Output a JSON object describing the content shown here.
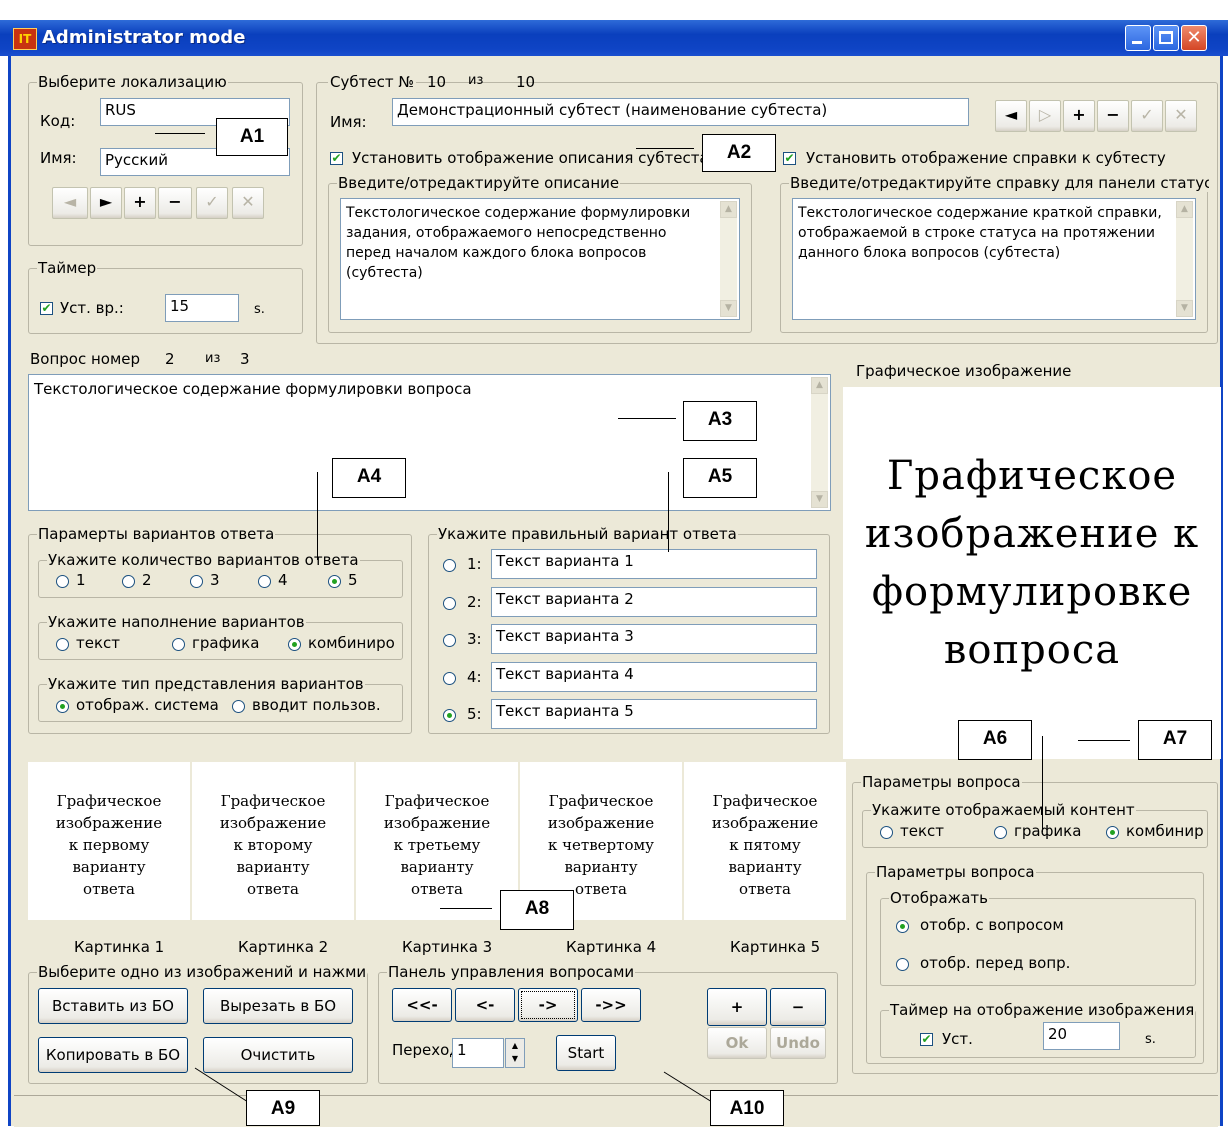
{
  "window": {
    "title": "Administrator mode"
  },
  "localization": {
    "group_title": "Выберите локализацию",
    "code_label": "Код:",
    "code_value": "RUS",
    "name_label": "Имя:",
    "name_value": "Русский"
  },
  "timer": {
    "group_title": "Таймер",
    "check_label": "Уст. вр.:",
    "value": "15",
    "unit": "s."
  },
  "subtest": {
    "label_no": "Субтест №",
    "number": "10",
    "of_label": "из",
    "total": "10",
    "name_label": "Имя:",
    "name_value": "Демонстрационный субтест (наименование субтеста)",
    "show_desc_label": "Установить отображение описания субтеста",
    "show_help_label": "Установить отображение справки к субтесту",
    "desc_group_title": "Введите/отредактируйте описание",
    "desc_text": "Текстологическое содержание формулировки задания, отображаемого непосредственно перед началом каждого блока вопросов (субтеста)",
    "help_group_title": "Введите/отредактируйте справку для панели статус",
    "help_text": "Текстологическое содержание краткой справки, отображаемой в строке статуса на протяжении данного блока вопросов (субтеста)"
  },
  "question": {
    "label": "Вопрос номер",
    "number": "2",
    "of_label": "из",
    "total": "3",
    "text": "Текстологическое содержание формулировки вопроса"
  },
  "graphic": {
    "label": "Графическое изображение",
    "image_text": "Графическое изображение к формулировке вопроса"
  },
  "answer_params": {
    "group_title": "Парамерты вариантов ответа",
    "count_title": "Укажите количество вариантов ответа",
    "count_options": [
      "1",
      "2",
      "3",
      "4",
      "5"
    ],
    "count_selected": "5",
    "fill_title": "Укажите наполнение вариантов",
    "fill_options": [
      "текст",
      "графика",
      "комбиниро"
    ],
    "fill_selected": "комбиниро",
    "type_title": "Укажите тип представления вариантов",
    "type_options": [
      "отображ. система",
      "вводит пользов."
    ],
    "type_selected": "отображ. система"
  },
  "correct": {
    "group_title": "Укажите правильный вариант ответа",
    "options": [
      {
        "num": "1:",
        "text": "Текст варианта 1"
      },
      {
        "num": "2:",
        "text": "Текст варианта 2"
      },
      {
        "num": "3:",
        "text": "Текст варианта 3"
      },
      {
        "num": "4:",
        "text": "Текст варианта 4"
      },
      {
        "num": "5:",
        "text": "Текст варианта 5"
      }
    ],
    "selected": "5"
  },
  "pictures": [
    {
      "text": "Графическое изображение к первому варианту ответа",
      "caption": "Картинка 1"
    },
    {
      "text": "Графическое изображение к второму варианту ответа",
      "caption": "Картинка 2"
    },
    {
      "text": "Графическое изображение к третьему варианту ответа",
      "caption": "Картинка 3"
    },
    {
      "text": "Графическое изображение к четвертому варианту ответа",
      "caption": "Картинка 4"
    },
    {
      "text": "Графическое изображение к пятому варианту ответа",
      "caption": "Картинка 5"
    }
  ],
  "clipboard": {
    "group_title": "Выберите одно из изображений и нажми",
    "insert": "Вставить из БО",
    "cut": "Вырезать в БО",
    "copy": "Копировать в БО",
    "clear": "Очистить"
  },
  "qpanel": {
    "group_title": "Панель управления вопросами",
    "first": "<<-",
    "prev": "<-",
    "next": "->",
    "last": "->>",
    "add": "+",
    "remove": "−",
    "ok": "Ok",
    "undo": "Undo",
    "goto_label": "Переход",
    "goto_value": "1",
    "start": "Start"
  },
  "qparams": {
    "group_title": "Параметры вопроса",
    "content_title": "Укажите отображаемый контент",
    "content_options": [
      "текст",
      "графика",
      "комбинир"
    ],
    "content_selected": "комбинир",
    "inner_title": "Параметры вопроса",
    "display_title": "Отображать",
    "display_options": [
      "отобр. с вопросом",
      "отобр. перед вопр."
    ],
    "display_selected": "отобр. с вопросом",
    "timer_title": "Таймер на отображение изображения",
    "timer_check": "Уст.",
    "timer_value": "20",
    "timer_unit": "s."
  },
  "callouts": [
    "A1",
    "A2",
    "A3",
    "A4",
    "A5",
    "A6",
    "A7",
    "A8",
    "A9",
    "A10"
  ],
  "colors": {
    "titlebar": "#0f44c5",
    "face": "#ece9d8",
    "check": "#21a121"
  }
}
